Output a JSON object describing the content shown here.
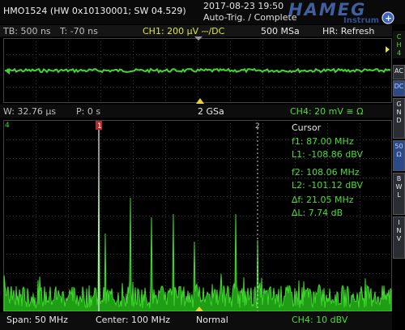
{
  "header": {
    "device_id": "HMO1524 (HW 0x10130001; SW 04.529)",
    "datetime": "2017-08-23 19:50",
    "trigger_status": "Auto-Trig. / Complete",
    "logo_text": "HAMEG",
    "logo_sub": "Instrum"
  },
  "channel_bar": {
    "timebase": "TB: 500 ns",
    "trigger_time": "T: -70 ns",
    "ch1": "CH1: 200 µV ⎓/DC",
    "sample_rate": "500 MSa",
    "hr": "HR: Refresh"
  },
  "info_bar": {
    "window": "W: 32.76 µs",
    "position": "P: 0 s",
    "gsa": "2 GSa",
    "ch4": "CH4: 20 mV ≅ Ω"
  },
  "cursor": {
    "title": "Cursor",
    "f1": "f1: 87.00 MHz",
    "l1": "L1: -108.86 dBV",
    "f2": "f2: 108.06 MHz",
    "l2": "L2: -101.12 dBV",
    "df": "∆f: 21.05 MHz",
    "dl": "∆L: 7.74 dB",
    "marker1_label": "1",
    "marker2_label": "2"
  },
  "bottom_bar": {
    "span": "Span: 50 MHz",
    "center": "Center: 100 MHz",
    "mode": "Normal",
    "ch4_scale": "CH4: 10 dBV"
  },
  "side_menu": {
    "ch_label": "CH4",
    "items": [
      "AC",
      "DC",
      "GND",
      "50Ω",
      "BWL",
      "INV"
    ]
  },
  "trace": {
    "ch_marker": "4",
    "color": "#3fd82e"
  }
}
